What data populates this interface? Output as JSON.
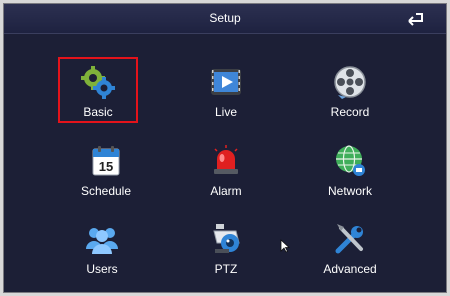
{
  "window": {
    "title": "Setup",
    "back_icon": "back-arrow-icon",
    "selected_item": "Basic",
    "selection_color": "#e3131b",
    "background_color": "#1c1f36"
  },
  "menu": {
    "items": [
      {
        "label": "Basic",
        "icon": "gears-icon"
      },
      {
        "label": "Live",
        "icon": "video-play-icon"
      },
      {
        "label": "Record",
        "icon": "film-reel-icon"
      },
      {
        "label": "Schedule",
        "icon": "calendar-icon"
      },
      {
        "label": "Alarm",
        "icon": "siren-icon"
      },
      {
        "label": "Network",
        "icon": "globe-network-icon"
      },
      {
        "label": "Users",
        "icon": "users-icon"
      },
      {
        "label": "PTZ",
        "icon": "ptz-camera-icon"
      },
      {
        "label": "Advanced",
        "icon": "tools-icon"
      }
    ],
    "calendar_day": "15"
  }
}
